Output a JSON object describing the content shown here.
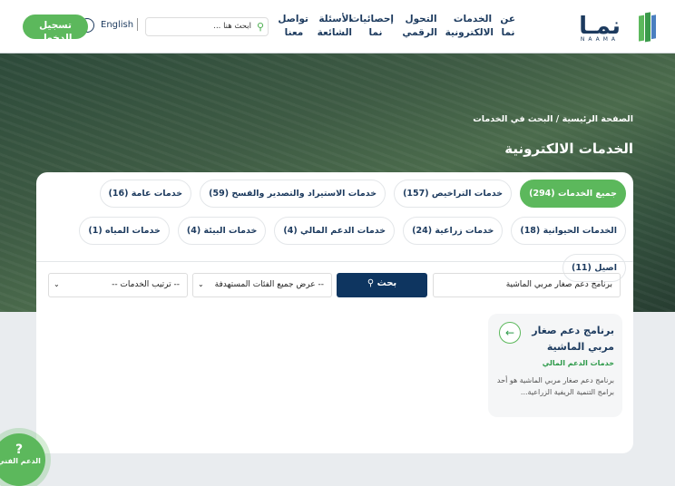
{
  "header": {
    "logo_text": "نمـا",
    "logo_sub": "NAAMA",
    "nav": [
      "عن نما",
      "الخدمات الالكترونية",
      "التحول الرقمي",
      "إحصائيات نما",
      "الأسئلة الشائعة",
      "تواصل معنا"
    ],
    "search_placeholder": "ابحث هنا ...",
    "language": "English",
    "register": "تسجيل الدخول"
  },
  "breadcrumb": {
    "home": "الصفحة الرئيسية",
    "sep": "/",
    "current": "البحث في الخدمات"
  },
  "page_title": "الخدمات الالكترونية",
  "chips": [
    {
      "label": "جميع الخدمات (294)",
      "active": true
    },
    {
      "label": "خدمات التراخيص (157)"
    },
    {
      "label": "خدمات الاستيراد والتصدير والفسح (59)"
    },
    {
      "label": "خدمات عامة (16)"
    },
    {
      "label": "الخدمات الحيوانية (18)"
    },
    {
      "label": "خدمات زراعية (24)"
    },
    {
      "label": "خدمات الدعم المالي (4)"
    },
    {
      "label": "خدمات البيئة (4)"
    },
    {
      "label": "خدمات المياه (1)"
    },
    {
      "label": "اصيل (11)"
    }
  ],
  "filters": {
    "keyword": "برنامج دعم صغار مربي الماشية",
    "search_button": "بحث",
    "category": "-- عرض جميع الفئات المستهدفة",
    "sort": "-- ترتيب الخدمات --"
  },
  "results": [
    {
      "title": "برنامج دعم صغار مربي الماشية",
      "category": "خدمات الدعم المالي",
      "description": "برنامج دعم صغار مربي الماشية هو أحد برامج التنمية الريفية الزراعية..."
    }
  ],
  "support": {
    "label": "الدعم الفني"
  },
  "colors": {
    "primary": "#5cb85c",
    "navy": "#0e3560",
    "text": "#1c3a5e"
  }
}
